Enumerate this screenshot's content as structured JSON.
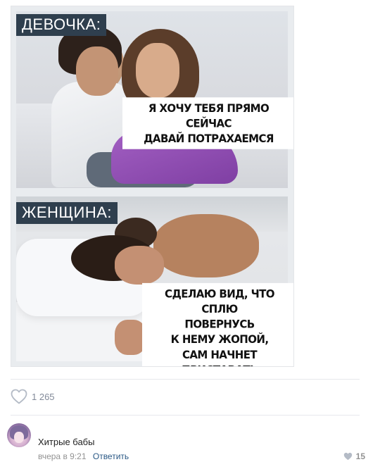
{
  "meme": {
    "top_label": "ДЕВОЧКА:",
    "top_caption_line1": "Я ХОЧУ ТЕБЯ ПРЯМО СЕЙЧАС",
    "top_caption_line2": "ДАВАЙ ПОТРАХАЕМСЯ",
    "bottom_label": "ЖЕНЩИНА:",
    "bottom_caption_line1": "СДЕЛАЮ ВИД, ЧТО СПЛЮ",
    "bottom_caption_line2": "ПОВЕРНУСЬ",
    "bottom_caption_line3": "К НЕМУ ЖОПОЙ,",
    "bottom_caption_line4": "САМ НАЧНЕТ ПРИСТАВАТЬ"
  },
  "post": {
    "likes_count": "1 265",
    "like_icon": "heart-outline-icon"
  },
  "comment": {
    "author": "Хитрые бабы",
    "time": "вчера в 9:21",
    "reply_label": "Ответить",
    "likes_count": "15",
    "like_icon": "heart-icon"
  },
  "colors": {
    "label_bg": "#2f3f4e",
    "link": "#2a5885",
    "muted": "#939393"
  }
}
